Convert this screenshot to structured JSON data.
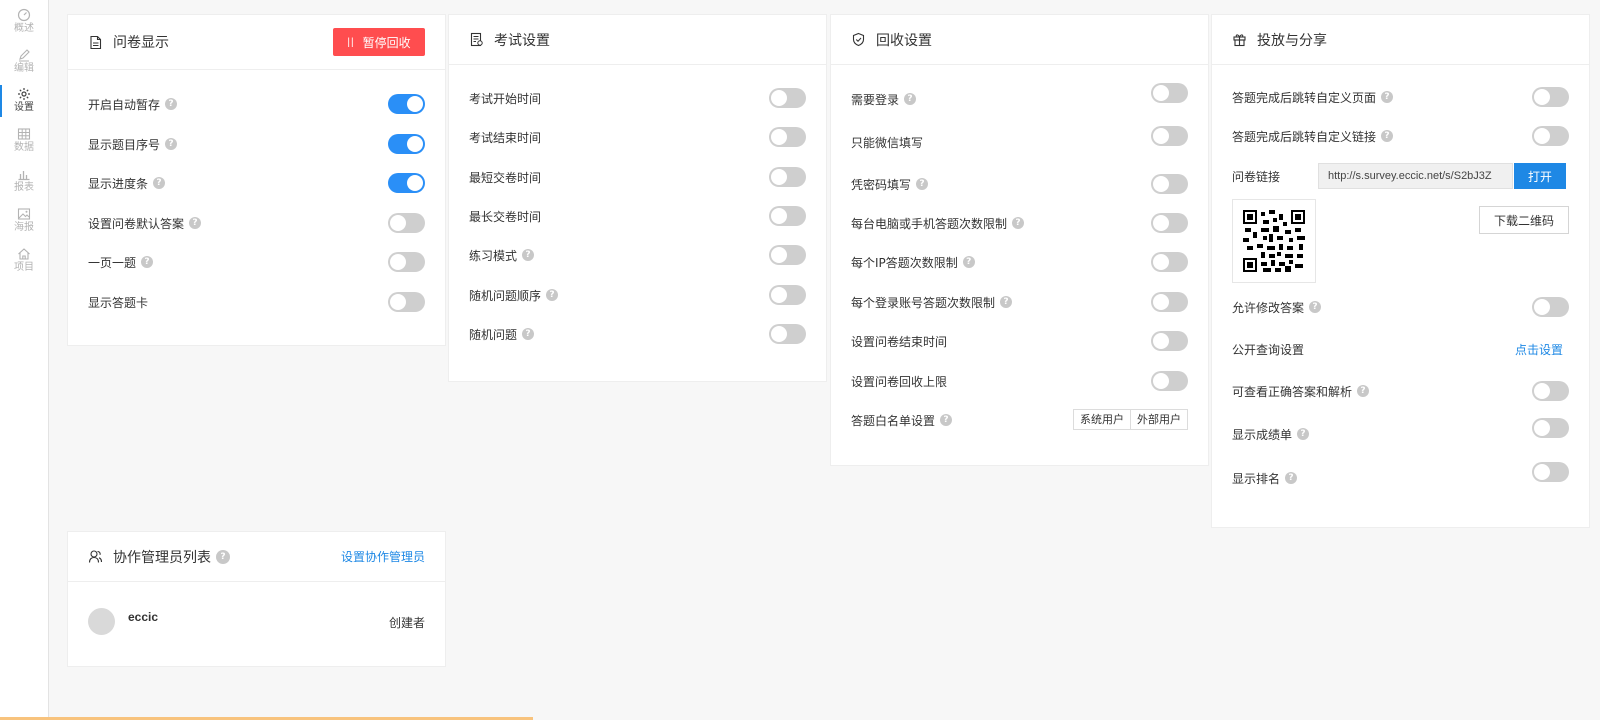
{
  "sidebar": {
    "items": [
      {
        "label": "概述",
        "icon": "dashboard-icon"
      },
      {
        "label": "编辑",
        "icon": "pencil-icon"
      },
      {
        "label": "设置",
        "icon": "gear-icon",
        "active": true
      },
      {
        "label": "数据",
        "icon": "table-icon"
      },
      {
        "label": "报表",
        "icon": "bar-chart-icon"
      },
      {
        "label": "海报",
        "icon": "image-icon"
      },
      {
        "label": "项目",
        "icon": "home-icon"
      }
    ]
  },
  "survey_display": {
    "title": "问卷显示",
    "pause_button": "暂停回收",
    "pause_icon": "||",
    "options": [
      {
        "label": "开启自动暂存",
        "help": true,
        "on": true
      },
      {
        "label": "显示题目序号",
        "help": true,
        "on": true
      },
      {
        "label": "显示进度条",
        "help": true,
        "on": true
      },
      {
        "label": "设置问卷默认答案",
        "help": true,
        "on": false
      },
      {
        "label": "一页一题",
        "help": true,
        "on": false
      },
      {
        "label": "显示答题卡",
        "help": false,
        "on": false
      }
    ]
  },
  "exam_settings": {
    "title": "考试设置",
    "options": [
      {
        "label": "考试开始时间",
        "help": false,
        "on": false
      },
      {
        "label": "考试结束时间",
        "help": false,
        "on": false
      },
      {
        "label": "最短交卷时间",
        "help": false,
        "on": false
      },
      {
        "label": "最长交卷时间",
        "help": false,
        "on": false
      },
      {
        "label": "练习模式",
        "help": true,
        "on": false
      },
      {
        "label": "随机问题顺序",
        "help": true,
        "on": false
      },
      {
        "label": "随机问题",
        "help": true,
        "on": false
      }
    ]
  },
  "collect_settings": {
    "title": "回收设置",
    "options": [
      {
        "label": "需要登录",
        "help": true,
        "on": false
      },
      {
        "label": "只能微信填写",
        "help": false,
        "on": false
      },
      {
        "label": "凭密码填写",
        "help": true,
        "on": false
      },
      {
        "label": "每台电脑或手机答题次数限制",
        "help": true,
        "on": false
      },
      {
        "label": "每个IP答题次数限制",
        "help": true,
        "on": false
      },
      {
        "label": "每个登录账号答题次数限制",
        "help": true,
        "on": false
      },
      {
        "label": "设置问卷结束时间",
        "help": false,
        "on": false
      },
      {
        "label": "设置问卷回收上限",
        "help": false,
        "on": false
      }
    ],
    "whitelist_label": "答题白名单设置",
    "whitelist_options": [
      "系统用户",
      "外部用户"
    ]
  },
  "distribute": {
    "title": "投放与分享",
    "redirect_page": "答题完成后跳转自定义页面",
    "redirect_link": "答题完成后跳转自定义链接",
    "link_label": "问卷链接",
    "link_url": "http://s.survey.eccic.net/s/S2bJ3Z",
    "open_button": "打开",
    "download_qr": "下载二维码",
    "allow_modify": "允许修改答案",
    "public_query": "公开查询设置",
    "public_query_link": "点击设置",
    "view_answers": "可查看正确答案和解析",
    "show_scores": "显示成绩单",
    "show_rank": "显示排名"
  },
  "collaborators": {
    "title": "协作管理员列表",
    "set_link": "设置协作管理员",
    "members": [
      {
        "name": "eccic",
        "role": "创建者"
      }
    ]
  },
  "colors": {
    "accent": "#1e88e5",
    "danger": "#ff4d4f",
    "toggle_on": "#2a8ff7",
    "toggle_off": "#cfcfcf"
  }
}
